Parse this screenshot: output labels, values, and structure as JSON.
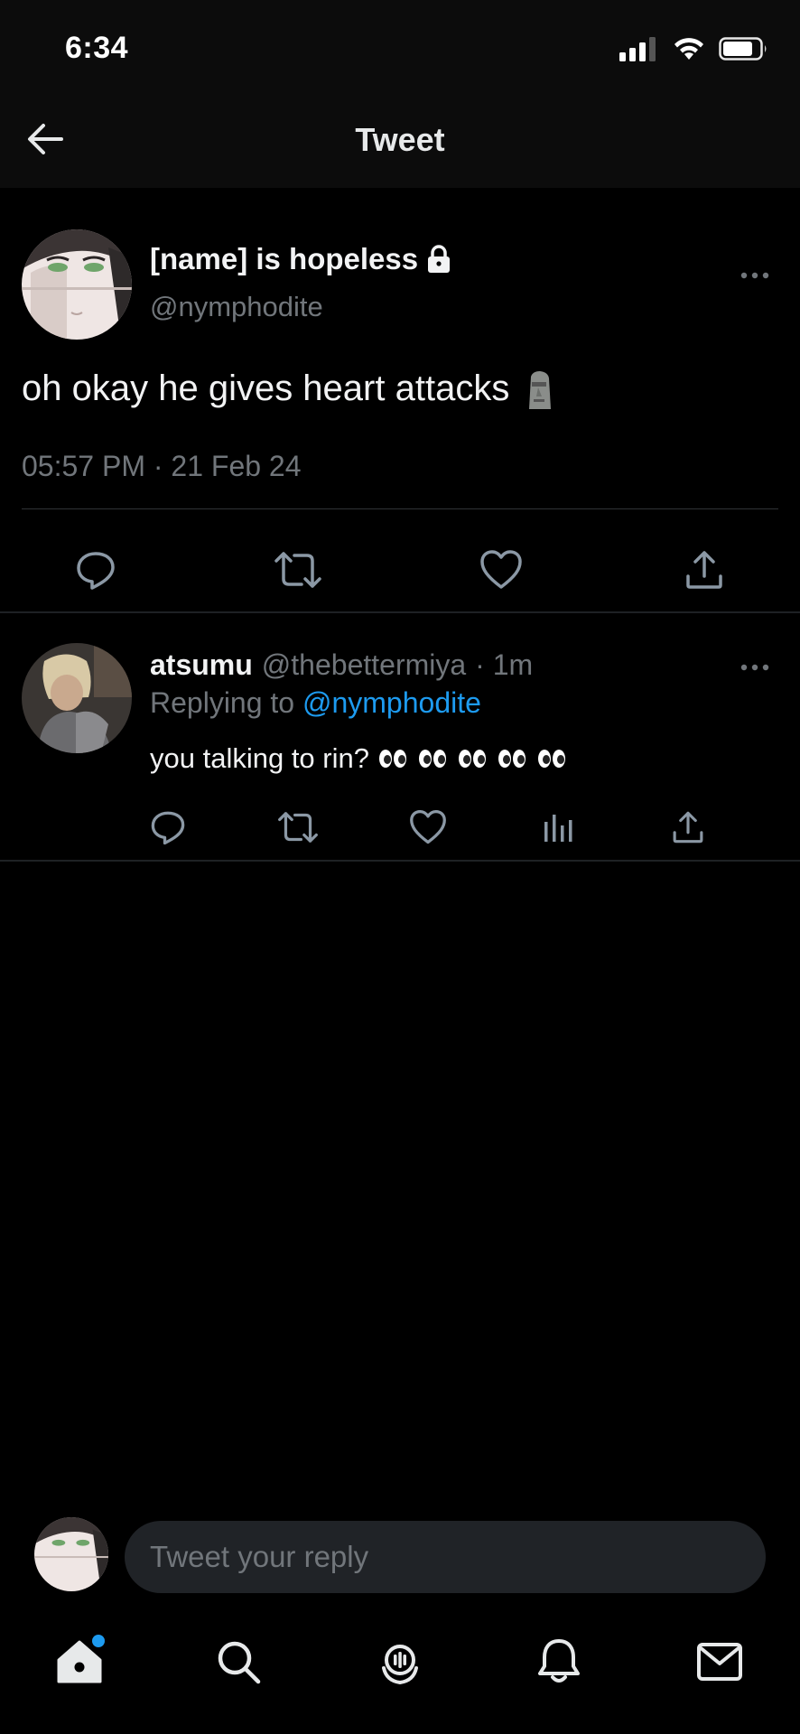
{
  "status_bar": {
    "time": "6:34"
  },
  "header": {
    "title": "Tweet"
  },
  "main_tweet": {
    "display_name": "[name] is hopeless",
    "handle": "@nymphodite",
    "protected": true,
    "text": "oh okay he gives heart attacks",
    "emoji": "moai",
    "timestamp": "05:57 PM · 21 Feb 24"
  },
  "reply": {
    "display_name": "atsumu",
    "handle": "@thebettermiya",
    "age": "· 1m",
    "replying_prefix": "Replying to",
    "replying_to": "@nymphodite",
    "text": "you talking to rin?",
    "emoji_count": 5,
    "emoji": "eyes"
  },
  "compose": {
    "placeholder": "Tweet your reply"
  },
  "colors": {
    "accent": "#1d9bf0",
    "muted": "#71767b",
    "background": "#000000"
  },
  "tabbar": {
    "items": [
      "home-icon",
      "search-icon",
      "spaces-icon",
      "notifications-icon",
      "messages-icon"
    ],
    "home_has_badge": true
  }
}
